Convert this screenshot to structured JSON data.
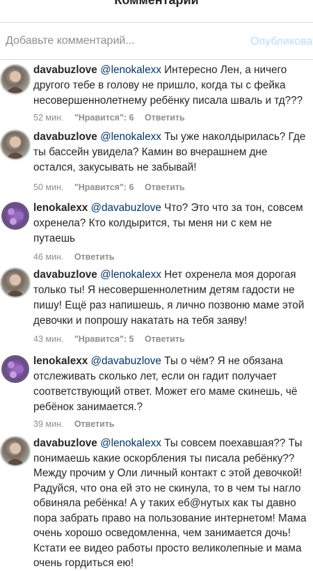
{
  "header": {
    "title": "Комментарии"
  },
  "composer": {
    "placeholder": "Добавьте комментарий...",
    "publish_label": "Опубликовать"
  },
  "icons": {
    "avatar_self": "avatar-photo",
    "avatar_other": "flower-photo"
  },
  "comments": [
    {
      "username": "davabuzlove",
      "mention": "@lenokalexx",
      "text": "Интересно Лен, а ничего другого тебе в голову не пришло, когда ты с фейка несовершеннолетнему ребёнку писала шваль и тд???",
      "time": "52 мин.",
      "likes": "\"Нравится\": 6",
      "reply": "Ответить"
    },
    {
      "username": "davabuzlove",
      "mention": "@lenokalexx",
      "text": "Ты уже наколдырилась? Где ты бассейн увидела? Камин во вчерашнем дне остался, закусывать не забывай!",
      "time": "50 мин.",
      "likes": "\"Нравится\": 6",
      "reply": "Ответить"
    },
    {
      "username": "lenokalexx",
      "mention": "@davabuzlove",
      "text": "Что? Это что за тон, совсем охренела? Кто колдырится, ты меня ни с кем не путаешь",
      "time": "46 мин.",
      "likes": "",
      "reply": "Ответить"
    },
    {
      "username": "davabuzlove",
      "mention": "@lenokalexx",
      "text": "Нет охренела моя дорогая только ты! Я несовершеннолетним детям гадости не пишу! Ещё раз напишешь, я лично позвоню маме этой девочки и попрошу накатать на тебя заяву!",
      "time": "43 мин.",
      "likes": "\"Нравится\": 5",
      "reply": "Ответить"
    },
    {
      "username": "lenokalexx",
      "mention": "@davabuzlove",
      "text": "Ты о чём? Я не обязана отслеживать сколько лет, если он гадит получает соответствующий ответ. Может его маме скинешь, чё ребёнок занимается.?",
      "time": "39 мин.",
      "likes": "",
      "reply": "Ответить"
    },
    {
      "username": "davabuzlove",
      "mention": "@lenokalexx",
      "text": "Ты совсем поехавшая?? Ты понимаешь какие оскорбления ты писала ребёнку?? Между прочим у Оли личный контакт с этой девочкой! Радуйся, что она ей это не скинула, то в чем ты нагло обвиняла ребёнка! А у таких еб@нутых как ты давно пора забрать право на пользование интернетом! Мама очень хорошо осведомленна, чем занимается дочь! Кстати ее видео работы просто великолепные и мама очень гордиться ею!",
      "time": "",
      "likes": "",
      "reply": ""
    }
  ]
}
